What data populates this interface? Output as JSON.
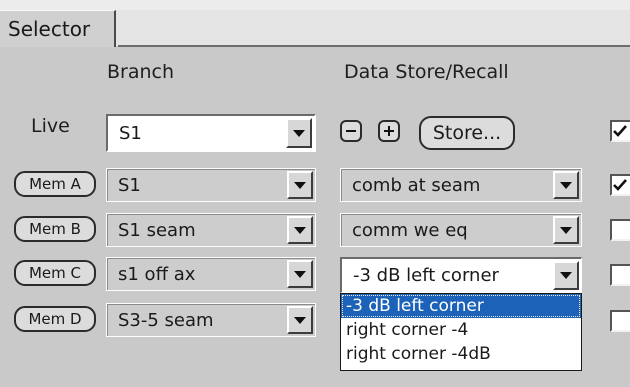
{
  "tab": {
    "label": "Selector"
  },
  "headers": {
    "branch": "Branch",
    "data_store": "Data Store/Recall"
  },
  "live": {
    "label": "Live",
    "branch_value": "S1",
    "minus": "−",
    "plus": "+",
    "store_label": "Store...",
    "checked": true
  },
  "mem_rows": [
    {
      "button": "Mem A",
      "branch": "S1",
      "store": "comb at seam",
      "checked": true
    },
    {
      "button": "Mem B",
      "branch": "S1 seam",
      "store": "comm we eq",
      "checked": false
    },
    {
      "button": "Mem C",
      "branch": "s1 off ax",
      "store": "-3 dB left corner",
      "checked": false
    },
    {
      "button": "Mem D",
      "branch": "S3-5 seam",
      "store": "",
      "checked": false
    }
  ],
  "dropdown": {
    "options": [
      "-3 dB left corner",
      "right corner -4",
      "right corner -4dB"
    ],
    "selected_index": 0
  },
  "icons": {
    "arrow": "chevron-down-icon",
    "check": "checkmark-icon",
    "minus": "minus-icon",
    "plus": "plus-icon"
  }
}
